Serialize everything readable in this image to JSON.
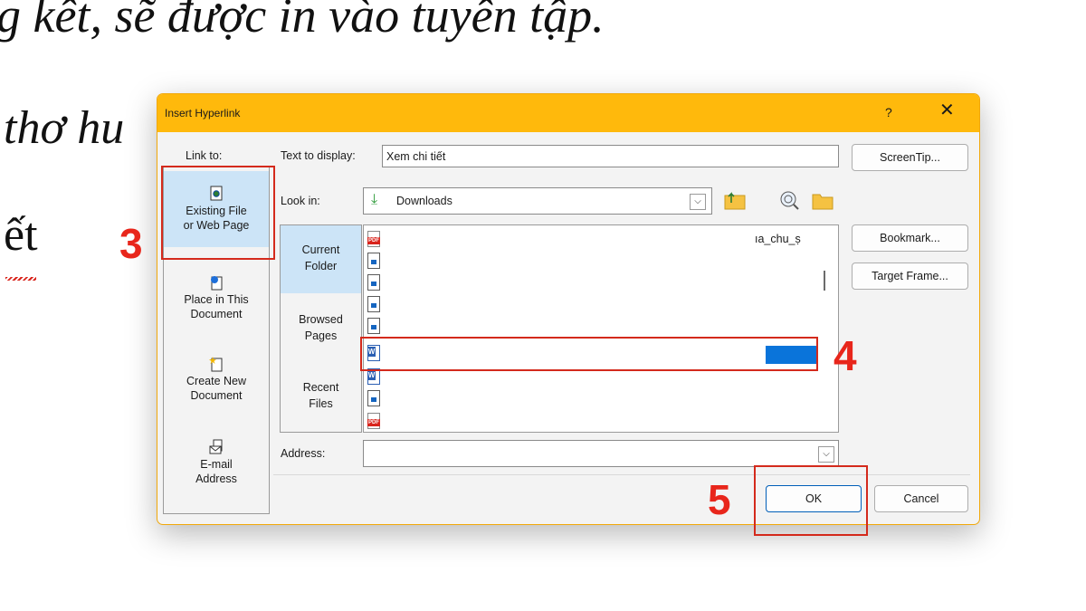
{
  "background": {
    "line1": "g kêt, sẽ được in vào tuyên tập.",
    "line2": "thơ hu",
    "line3": "ết"
  },
  "dialog": {
    "title": "Insert Hyperlink",
    "help_label": "?",
    "close_label": "✕",
    "link_to_label": "Link to:",
    "text_to_display_label": "Text to display:",
    "text_to_display_value": "Xem chi tiết",
    "screentip_label": "ScreenTip...",
    "look_in_label": "Look in:",
    "look_in_value": "Downloads",
    "address_label": "Address:",
    "address_value": "",
    "bookmark_label": "Bookmark...",
    "target_frame_label": "Target Frame...",
    "ok_label": "OK",
    "cancel_label": "Cancel",
    "link_items": [
      {
        "label_a": "Existing File",
        "label_b": "or Web Page",
        "icon": "existing-file-icon",
        "selected": true
      },
      {
        "label_a": "Place in This",
        "label_b": "Document",
        "icon": "place-in-document-icon",
        "selected": false
      },
      {
        "label_a": "Create New",
        "label_b": "Document",
        "icon": "create-new-document-icon",
        "selected": false
      },
      {
        "label_a": "E-mail",
        "label_b": "Address",
        "icon": "email-address-icon",
        "selected": false
      }
    ],
    "nav_items": [
      {
        "label_a": "Current",
        "label_b": "Folder",
        "selected": true
      },
      {
        "label_a": "Browsed",
        "label_b": "Pages",
        "selected": false
      },
      {
        "label_a": "Recent",
        "label_b": "Files",
        "selected": false
      }
    ],
    "files": [
      {
        "type": "pdf",
        "name": "ıa_chu_ṣ"
      },
      {
        "type": "doc",
        "name": ""
      },
      {
        "type": "doc",
        "name": ""
      },
      {
        "type": "doc",
        "name": ""
      },
      {
        "type": "doc",
        "name": ""
      },
      {
        "type": "word",
        "name": "",
        "selected": true
      },
      {
        "type": "word",
        "name": ""
      },
      {
        "type": "doc",
        "name": ""
      },
      {
        "type": "pdf",
        "name": ""
      }
    ]
  },
  "annotations": {
    "step3": "3",
    "step4": "4",
    "step5": "5",
    "color": "#e8261b"
  },
  "colors": {
    "titlebar": "#ffb90c",
    "selection": "#cce4f7",
    "accent": "#0a74da"
  }
}
